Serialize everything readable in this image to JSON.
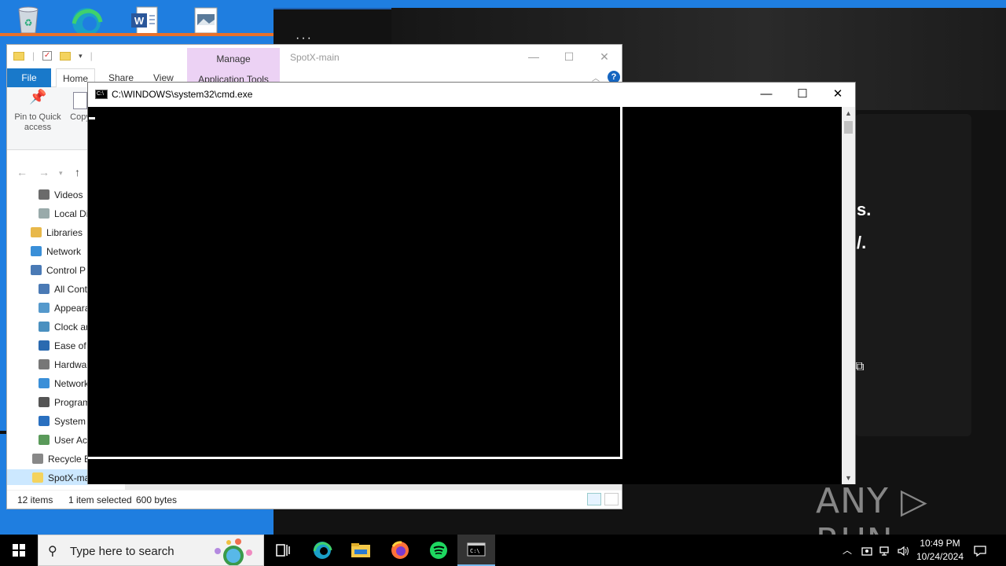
{
  "desktop": {
    "icons": [
      "recycle-bin",
      "microsoft-edge",
      "word-document",
      "image-file"
    ]
  },
  "spotify": {
    "text_s": "s.",
    "text_dot": "/."
  },
  "explorer": {
    "manage_tab": "Manage",
    "application_tools_tab": "Application Tools",
    "window_title": "SpotX-main",
    "tabs": {
      "file": "File",
      "home": "Home",
      "share": "Share",
      "view": "View"
    },
    "ribbon": {
      "pin_label": "Pin to Quick access",
      "copy_label": "Copy"
    },
    "tree": [
      {
        "label": "Videos",
        "color": "#6b6b6b"
      },
      {
        "label": "Local Di",
        "color": "#9aa"
      },
      {
        "label": "Libraries",
        "color": "#e8b84a"
      },
      {
        "label": "Network",
        "color": "#3a8fd8"
      },
      {
        "label": "Control P",
        "color": "#4a7ab5"
      },
      {
        "label": "All Cont",
        "color": "#4a7ab5"
      },
      {
        "label": "Appeara",
        "color": "#5599cc"
      },
      {
        "label": "Clock ar",
        "color": "#4a90c0"
      },
      {
        "label": "Ease of A",
        "color": "#2a6ab0"
      },
      {
        "label": "Hardwa",
        "color": "#777"
      },
      {
        "label": "Network",
        "color": "#3a8fd8"
      },
      {
        "label": "Program",
        "color": "#555"
      },
      {
        "label": "System",
        "color": "#2a70c0"
      },
      {
        "label": "User Acc",
        "color": "#5a9a5a"
      },
      {
        "label": "Recycle B",
        "color": "#888"
      },
      {
        "label": "SpotX-ma",
        "color": "#f4d35e"
      }
    ],
    "status": {
      "items": "12 items",
      "selected": "1 item selected",
      "size": "600 bytes"
    }
  },
  "cmd": {
    "title": "C:\\WINDOWS\\system32\\cmd.exe",
    "minimize": "—",
    "maximize": "☐",
    "close": "✕"
  },
  "watermark": "ANY ▷ RUN",
  "taskbar": {
    "search_placeholder": "Type here to search",
    "apps": [
      "task-view",
      "microsoft-edge",
      "file-explorer",
      "firefox",
      "spotify",
      "command-prompt"
    ],
    "clock_time": "10:49 PM",
    "clock_date": "10/24/2024"
  }
}
